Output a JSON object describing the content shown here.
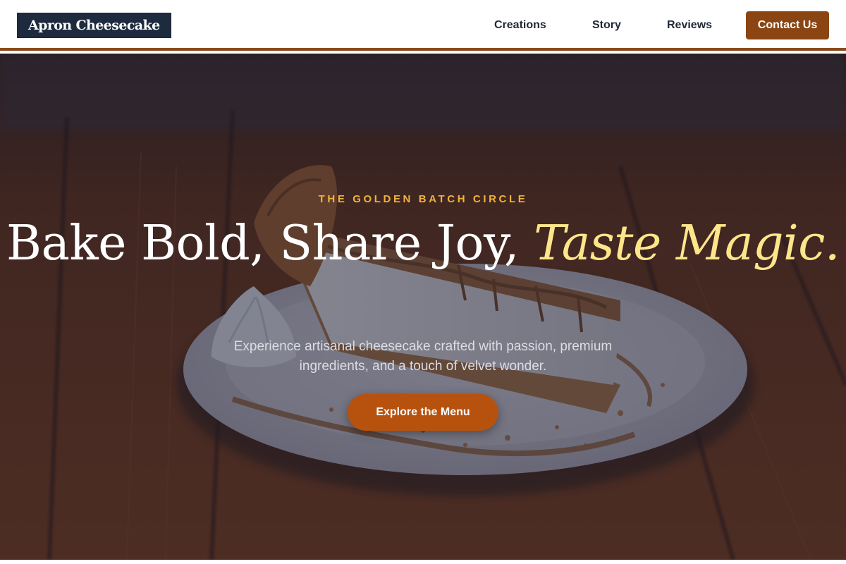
{
  "header": {
    "logo": "Apron Cheesecake",
    "nav": [
      {
        "label": "Creations"
      },
      {
        "label": "Story"
      },
      {
        "label": "Reviews"
      }
    ],
    "contact_label": "Contact Us"
  },
  "hero": {
    "eyebrow": "THE GOLDEN BATCH CIRCLE",
    "headline_plain": "Bake Bold, Share Joy,",
    "headline_accent": "Taste Magic.",
    "subtext": "Experience artisanal cheesecake crafted with passion, premium ingredients, and a touch of velvet wonder.",
    "cta_label": "Explore the Menu",
    "background_image": "cheesecake-slice-photo"
  },
  "colors": {
    "brand_dark": "#1e2a3e",
    "brand_brown": "#8a4513",
    "cta_orange": "#b7520e",
    "eyebrow_gold": "#f1b33c",
    "accent_yellow": "#fde68a"
  }
}
